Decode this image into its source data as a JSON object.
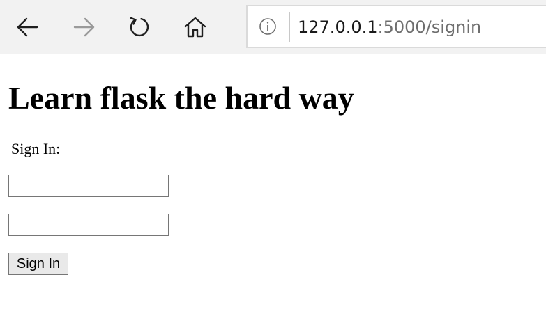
{
  "browser": {
    "icons": {
      "back": "arrow-left-icon",
      "forward": "arrow-right-icon",
      "refresh": "refresh-icon",
      "home": "home-icon",
      "info": "info-icon"
    },
    "forward_enabled": false,
    "address": {
      "host": "127.0.0.1",
      "rest": ":5000/signin"
    }
  },
  "page": {
    "title": "Learn flask the hard way",
    "form": {
      "label": "Sign In:",
      "username_value": "",
      "password_value": "",
      "submit_label": "Sign In"
    }
  },
  "colors": {
    "toolbar_bg": "#f2f2f2",
    "forward_disabled": "#9a9a9a",
    "url_host": "#1a1a1a",
    "url_rest": "#6e6e6e"
  }
}
